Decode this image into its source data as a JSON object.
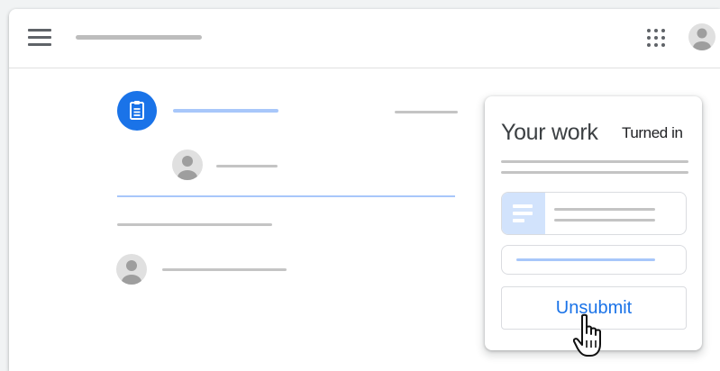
{
  "app": {
    "icons": {
      "menu": "hamburger-menu-icon",
      "apps": "apps-grid-icon",
      "account": "account-avatar-icon",
      "assignment": "assignment-clipboard-icon",
      "attachment": "document-icon",
      "cursor": "hand-pointer-cursor"
    },
    "colors": {
      "accent": "#1a73e8",
      "accent_light": "#a8c7fa",
      "attachment_bg": "#d2e3fc",
      "icon_gray": "#5f6368",
      "placeholder_gray": "#c4c4c4"
    }
  },
  "work_card": {
    "title": "Your work",
    "status": "Turned in",
    "unsubmit_label": "Unsubmit"
  }
}
